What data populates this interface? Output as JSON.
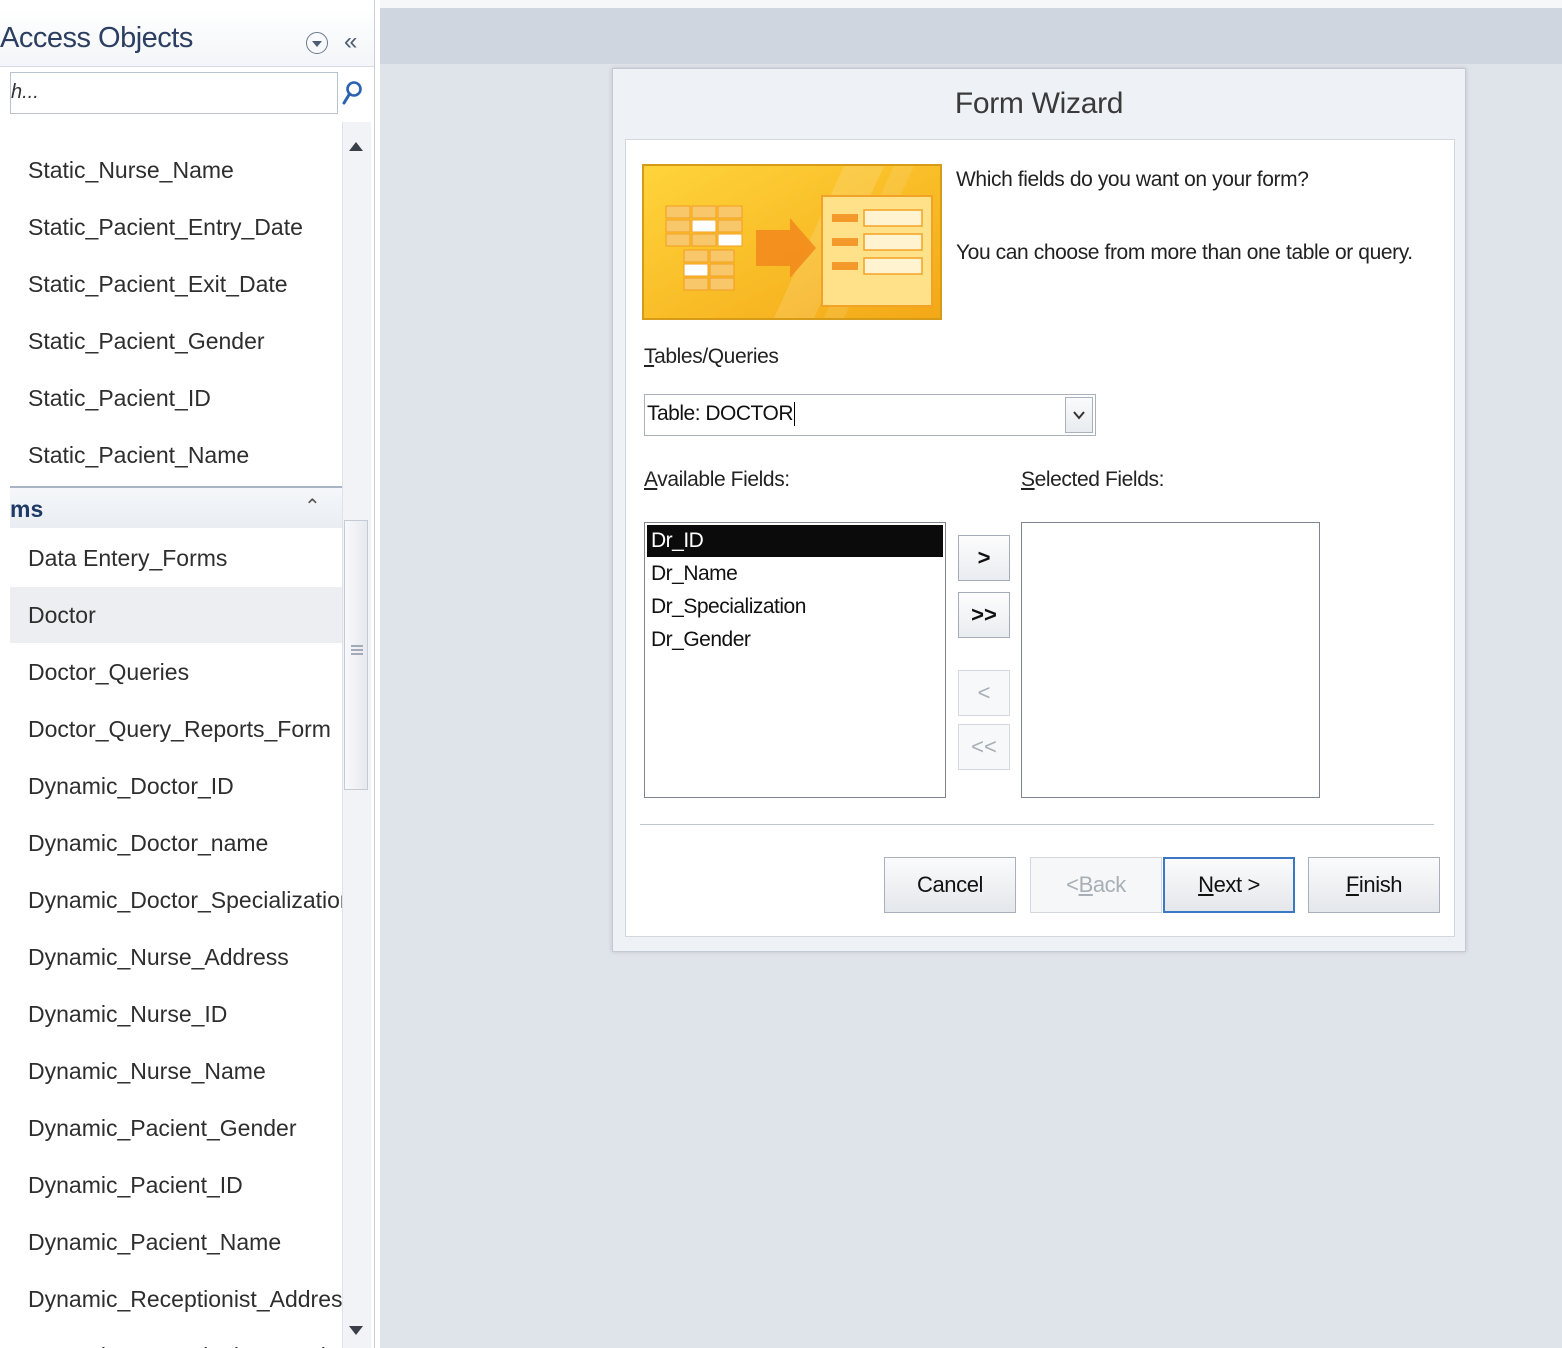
{
  "nav_pane": {
    "title": "Access Objects",
    "search_text": "h...",
    "tables_items_above": [
      "Static_Nurse_Name",
      "Static_Pacient_Entry_Date",
      "Static_Pacient_Exit_Date",
      "Static_Pacient_Gender",
      "Static_Pacient_ID",
      "Static_Pacient_Name"
    ],
    "forms_group_label": "ms",
    "forms_items": [
      "Data Entery_Forms",
      "Doctor",
      "Doctor_Queries",
      "Doctor_Query_Reports_Form",
      "Dynamic_Doctor_ID",
      "Dynamic_Doctor_name",
      "Dynamic_Doctor_Specialization",
      "Dynamic_Nurse_Address",
      "Dynamic_Nurse_ID",
      "Dynamic_Nurse_Name",
      "Dynamic_Pacient_Gender",
      "Dynamic_Pacient_ID",
      "Dynamic_Pacient_Name",
      "Dynamic_Receptionist_Address",
      "Dynamic_Receptionist_Gender"
    ],
    "selected_item": "Doctor"
  },
  "wizard": {
    "title": "Form Wizard",
    "question": "Which fields do you want on your form?",
    "hint": "You can choose from more than one table or query.",
    "tables_queries_label": {
      "mnemonic": "T",
      "rest": "ables/Queries"
    },
    "tables_queries_value": "Table: DOCTOR",
    "available_label": {
      "mnemonic": "A",
      "rest": "vailable Fields:"
    },
    "selected_label": {
      "mnemonic": "S",
      "rest": "elected Fields:"
    },
    "available_fields": [
      "Dr_ID",
      "Dr_Name",
      "Dr_Specialization",
      "Dr_Gender"
    ],
    "selected_available_field": "Dr_ID",
    "selected_fields": [],
    "move_buttons": {
      "add_one": ">",
      "add_all": ">>",
      "remove_one": "<",
      "remove_all": "<<"
    },
    "buttons": {
      "cancel": "Cancel",
      "back": {
        "pre": "< ",
        "mnemonic": "B",
        "rest": "ack"
      },
      "next": {
        "mnemonic": "N",
        "rest": "ext >"
      },
      "finish": {
        "mnemonic": "F",
        "rest": "inish"
      }
    }
  },
  "colors": {
    "nav_title": "#2c3f61",
    "group_label": "#1f3a66",
    "workspace": "#dfe3ea",
    "selection": "#0b0b0b",
    "default_button_border": "#3a78c4",
    "wizard_image_orange": "#f5b51e"
  },
  "icons": {
    "nav_menu": "dropdown-circle-icon",
    "nav_collapse": "double-chevron-left-icon",
    "search": "search-icon",
    "group_toggle": "double-chevron-up-icon",
    "combo_dropdown": "chevron-down-icon"
  }
}
